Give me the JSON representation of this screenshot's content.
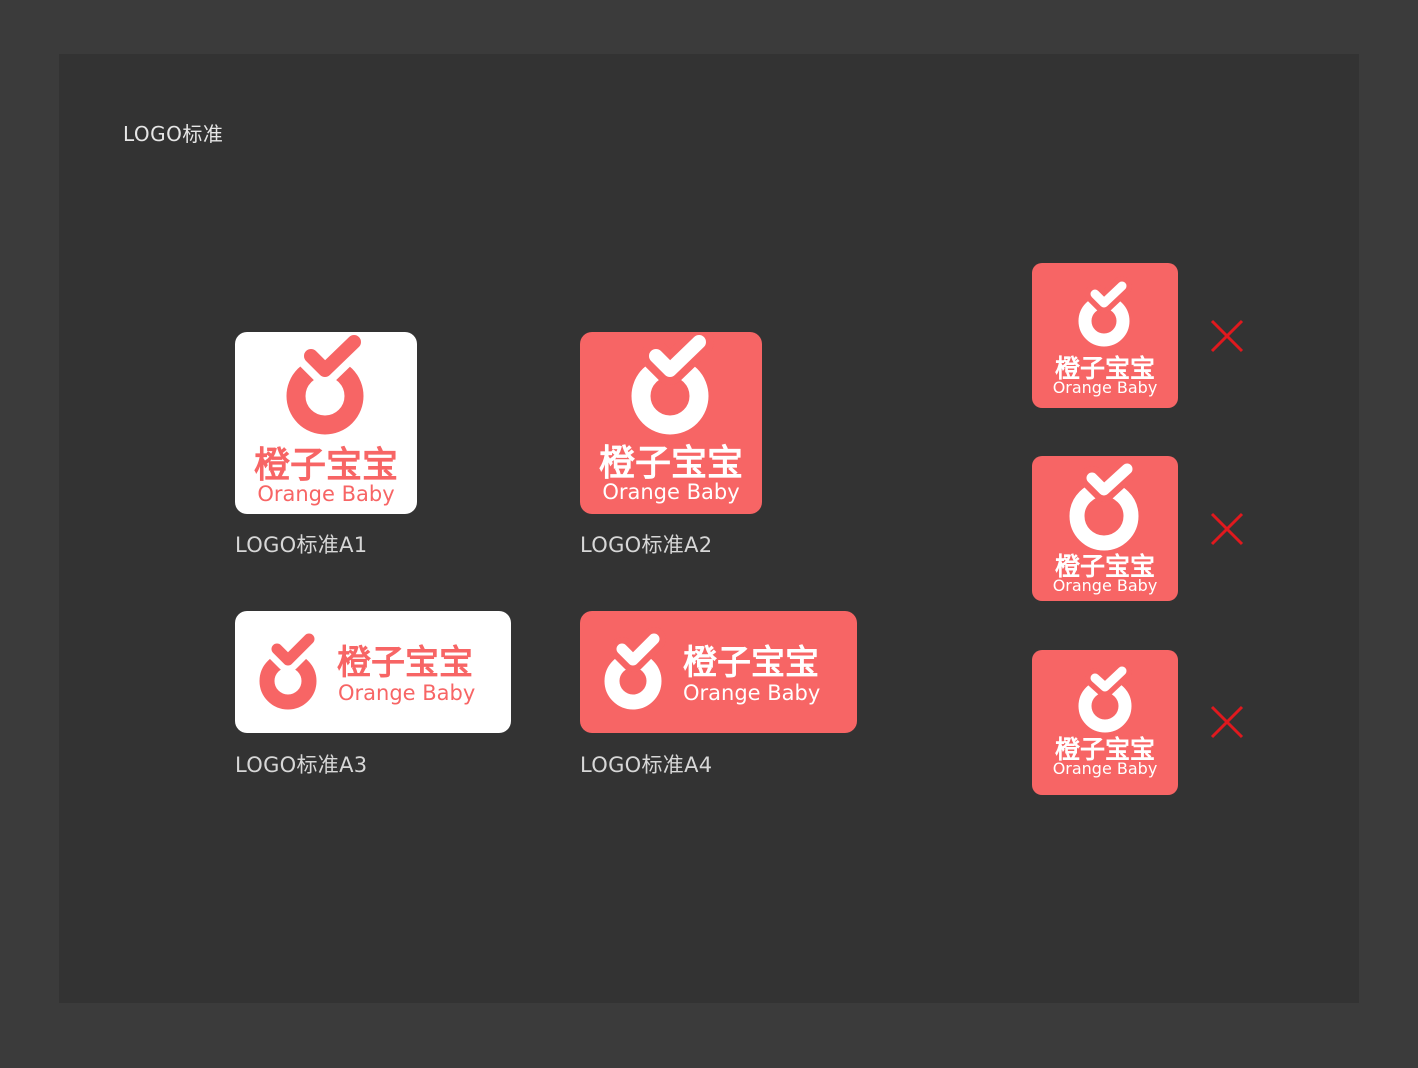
{
  "page": {
    "title": "LOGO标准"
  },
  "brand": {
    "name_cn": "橙子宝宝",
    "name_en": "Orange Baby",
    "colors": {
      "accent": "#f76565",
      "white": "#ffffff",
      "reject": "#e0191e",
      "panel": "#333333",
      "frame": "#3b3b3b"
    }
  },
  "logos": [
    {
      "id": "a1",
      "caption": "LOGO标准A1",
      "variant": "white-vertical"
    },
    {
      "id": "a2",
      "caption": "LOGO标准A2",
      "variant": "red-vertical"
    },
    {
      "id": "a3",
      "caption": "LOGO标准A3",
      "variant": "white-horizontal"
    },
    {
      "id": "a4",
      "caption": "LOGO标准A4",
      "variant": "red-horizontal"
    }
  ],
  "rejected": [
    {
      "id": "bad-1",
      "mark": "cross-icon"
    },
    {
      "id": "bad-2",
      "mark": "cross-icon"
    },
    {
      "id": "bad-3",
      "mark": "cross-icon"
    }
  ]
}
